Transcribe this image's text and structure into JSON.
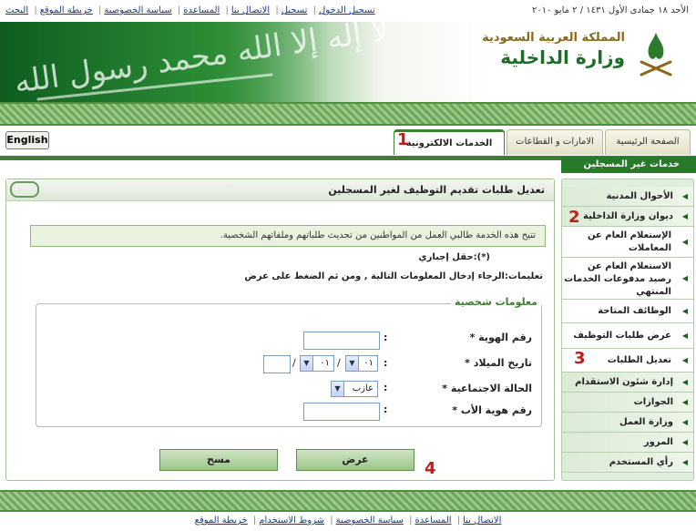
{
  "top_links": [
    "تسجيل الدخول",
    "تسجيل",
    "الاتصال بنا",
    "المساعدة",
    "سياسة الخصوصية",
    "خريطة الموقع",
    "البحث"
  ],
  "top_date": "الأحد ١٨ جمادى الأول ١٤٣١ / ٢ مايو ٢٠١٠",
  "header": {
    "kingdom": "المملكة العربية السعودية",
    "ministry": "وزارة الداخلية"
  },
  "tabs": {
    "english": "English",
    "home": "الصفحة الرئيسية",
    "emirates": "الامارات و القطاعات",
    "eservices": "الخدمات الالكترونية"
  },
  "subnav": "خدمات غير المسجلين",
  "panel": {
    "title": "تعديل طلبات تقديم التوظيف لغير المسجلين",
    "info": "تتيح هذه الخدمة طالبي العمل من المواطنين من تحديث طلباتهم وملفاتهم الشخصية.",
    "required_note": "(*):حقل إجباري",
    "instructions": "تعليمات:الرجاء إدخال المعلومات التالية , ومن ثم الضغط على عرض",
    "legend": "معلومات شخصية",
    "fields": {
      "id_number": "رقم الهوية *",
      "birth_date": "تاريخ الميلاد *",
      "marital_status": "الحالة الاجتماعية *",
      "father_id": "رقم هوية الأب *"
    },
    "birth_day": "٠١",
    "birth_month": "٠١",
    "date_sep": "/",
    "colon": ":",
    "marital_value": "عازب",
    "show_button": "عرض",
    "clear_button": "مسح"
  },
  "sidenav": [
    "الأحوال المدنية",
    "ديوان وزارة الداخلية",
    "الإستعلام العام عن المعاملات",
    "الاستعلام العام عن رصيد مدفوعات الخدمات المنتهي",
    "الوظائف المتاحة",
    "عرض طلبات التوظيف",
    "تعديل الطلبات",
    "إدارة شئون الاستقدام",
    "الجوازات",
    "وزارة العمل",
    "المرور",
    "رأي المستخدم"
  ],
  "markers": [
    "1",
    "2",
    "3",
    "4"
  ],
  "footer_links": [
    "الاتصال بنا",
    "المساعدة",
    "سياسة الخصوصية",
    "شروط الاستخدام",
    "خريطة الموقع"
  ],
  "colors": {
    "green": "#3d7e33",
    "dark_green": "#267a2a",
    "marker_red": "#c41a1a"
  }
}
